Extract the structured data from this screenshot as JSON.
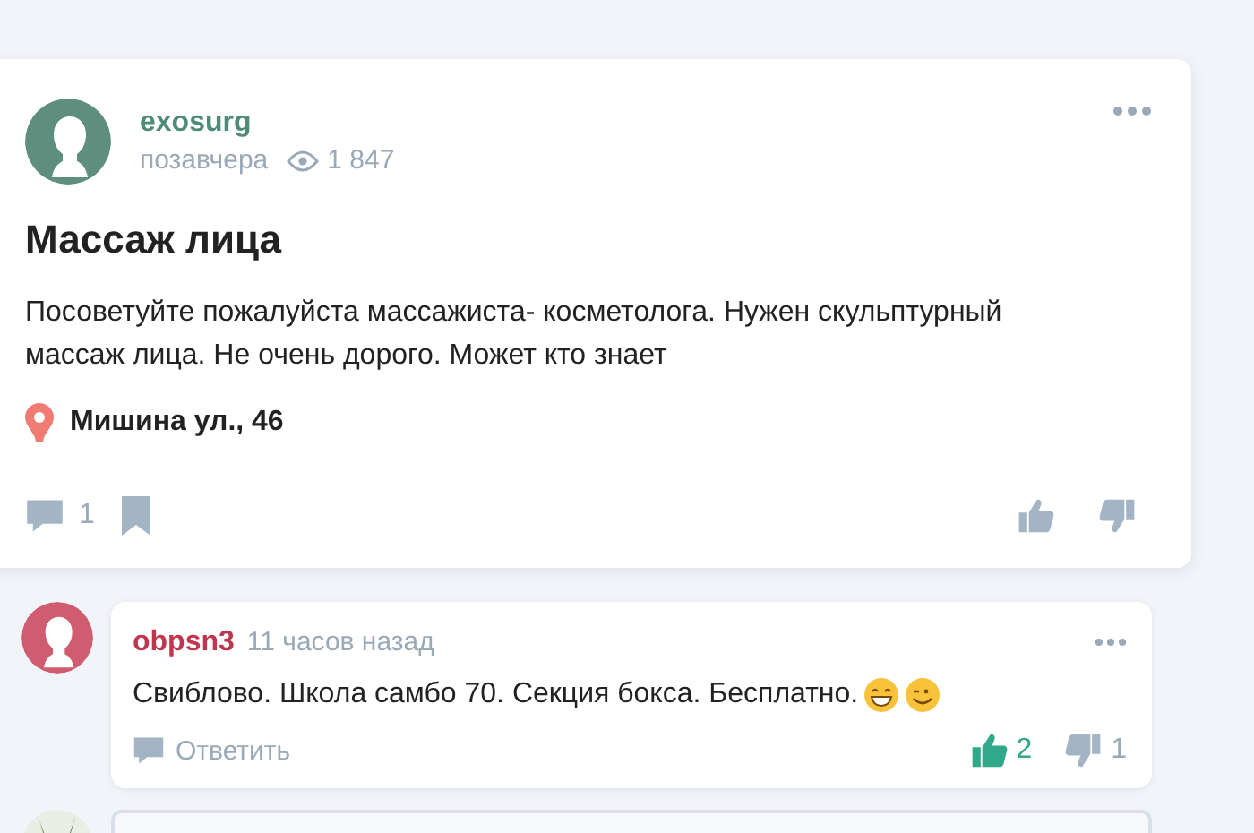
{
  "post": {
    "author": "exosurg",
    "time": "позавчера",
    "views": "1 847",
    "title": "Массаж лица",
    "text": "Посоветуйте пожалуйста массажиста- косметолога. Нужен скульптурный массаж лица. Не очень дорого. Может кто знает",
    "location": "Мишина ул., 46",
    "comment_count": "1",
    "liked": false,
    "disliked": false
  },
  "comments": [
    {
      "author": "obpsn3",
      "time": "11 часов назад",
      "text": "Свиблово. Школа самбо 70. Секция бокса. Бесплатно.",
      "reply": "Ответить",
      "likes": "2",
      "dislikes": "1",
      "liked": true,
      "disliked": false
    }
  ]
}
